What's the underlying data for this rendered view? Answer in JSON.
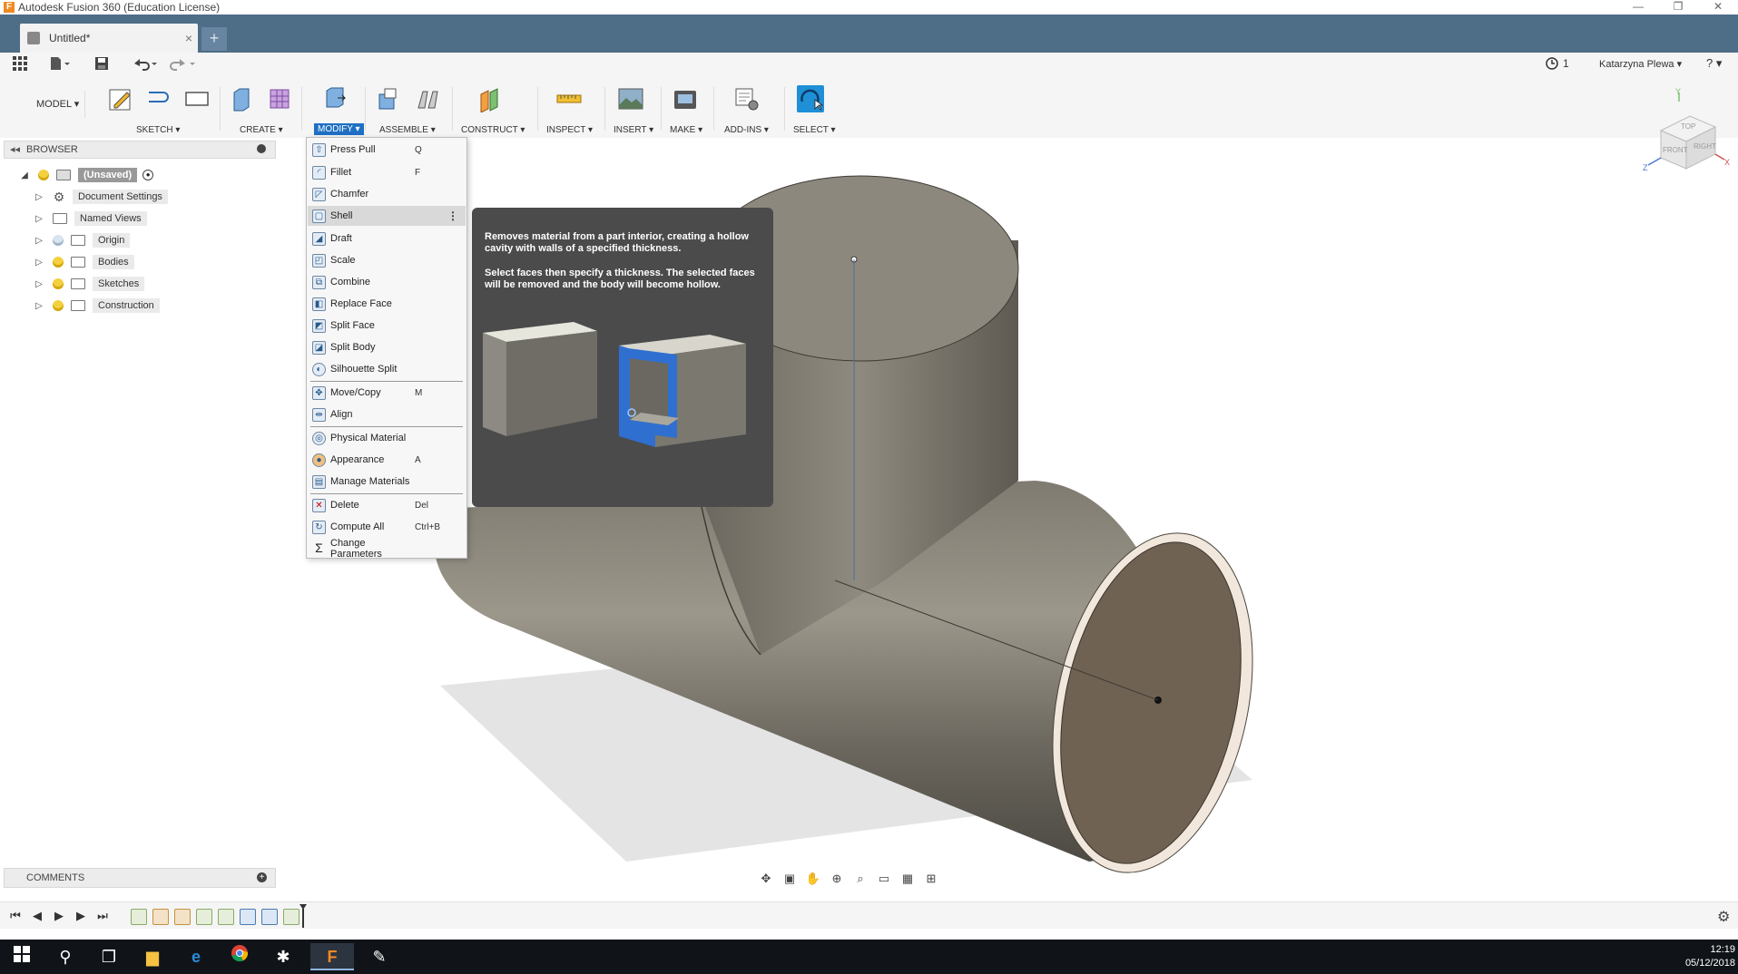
{
  "window": {
    "title": "Autodesk Fusion 360 (Education License)",
    "minimize": "—",
    "restore": "❐",
    "close": "✕"
  },
  "tabs": {
    "document_title": "Untitled*",
    "close": "×",
    "new_tab": "+"
  },
  "qat": {
    "job_status": "1",
    "user": "Katarzyna Plewa ▾",
    "help": "? ▾"
  },
  "ribbon": {
    "workspace": "MODEL ▾",
    "groups": {
      "sketch": "SKETCH ▾",
      "create": "CREATE ▾",
      "modify": "MODIFY ▾",
      "assemble": "ASSEMBLE ▾",
      "construct": "CONSTRUCT ▾",
      "inspect": "INSPECT ▾",
      "insert": "INSERT ▾",
      "make": "MAKE ▾",
      "addins": "ADD-INS ▾",
      "select": "SELECT ▾"
    }
  },
  "browser": {
    "title": "BROWSER",
    "items": [
      {
        "label": "(Unsaved)"
      },
      {
        "label": "Document Settings"
      },
      {
        "label": "Named Views"
      },
      {
        "label": "Origin"
      },
      {
        "label": "Bodies"
      },
      {
        "label": "Sketches"
      },
      {
        "label": "Construction"
      }
    ]
  },
  "comments": {
    "title": "COMMENTS",
    "add": "+"
  },
  "modify_menu": {
    "items": [
      {
        "label": "Press Pull",
        "key": "Q"
      },
      {
        "label": "Fillet",
        "key": "F"
      },
      {
        "label": "Chamfer",
        "key": ""
      },
      {
        "label": "Shell",
        "key": "",
        "more": "⋮"
      },
      {
        "label": "Draft",
        "key": ""
      },
      {
        "label": "Scale",
        "key": ""
      },
      {
        "label": "Combine",
        "key": ""
      },
      {
        "label": "Replace Face",
        "key": ""
      },
      {
        "label": "Split Face",
        "key": ""
      },
      {
        "label": "Split Body",
        "key": ""
      },
      {
        "label": "Silhouette Split",
        "key": ""
      },
      {
        "label": "Move/Copy",
        "key": "M"
      },
      {
        "label": "Align",
        "key": ""
      },
      {
        "label": "Physical Material",
        "key": ""
      },
      {
        "label": "Appearance",
        "key": "A"
      },
      {
        "label": "Manage Materials",
        "key": ""
      },
      {
        "label": "Delete",
        "key": "Del"
      },
      {
        "label": "Compute All",
        "key": "Ctrl+B"
      },
      {
        "label": "Change Parameters",
        "key": ""
      }
    ]
  },
  "tooltip": {
    "line1": "Removes material from a part interior, creating a hollow cavity with walls of a specified thickness.",
    "line2": "Select faces then specify a thickness. The selected faces will be removed and the body will become hollow."
  },
  "viewcube": {
    "top": "TOP",
    "front": "FRONT",
    "right": "RIGHT",
    "x": "X",
    "y": "Y",
    "z": "Z"
  },
  "taskbar": {
    "time": "12:19",
    "date": "05/12/2018"
  },
  "colors": {
    "tabbar": "#4e6d87",
    "accent": "#1f6fc5",
    "body": "#8a8478",
    "tooltip_bg": "#4b4b4b",
    "taskbar": "#101418"
  }
}
